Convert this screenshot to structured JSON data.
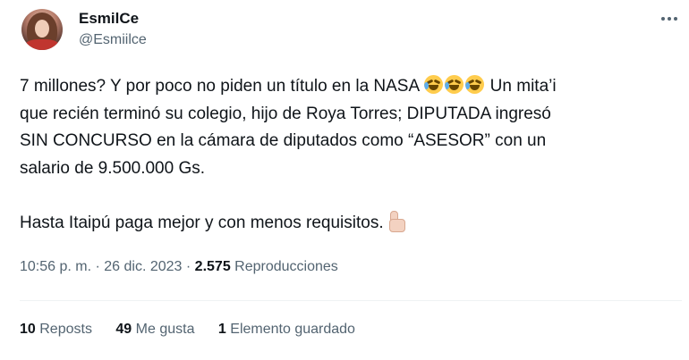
{
  "author": {
    "display_name": "EsmilCe",
    "handle": "@Esmiilce"
  },
  "tweet": {
    "line1_pre": "7 millones? Y por poco no piden un título en la NASA ",
    "line1_emojis": [
      "rolling-on-floor-laughing-emoji",
      "rolling-on-floor-laughing-emoji",
      "rolling-on-floor-laughing-emoji"
    ],
    "line1_post": " Un mita’i",
    "line2": "que recién terminó su colegio, hijo de Roya Torres; DIPUTADA ingresó",
    "line3": "SIN CONCURSO en la cámara de diputados como “ASESOR” con un",
    "line4": "salario de 9.500.000 Gs.",
    "line5": "Hasta Itaipú paga mejor y con menos requisitos.",
    "line5_emoji": "thumbs-up-emoji"
  },
  "meta": {
    "time": "10:56 p. m.",
    "separator": " · ",
    "date": "26 dic. 2023",
    "views_count": "2.575",
    "views_label": "Reproducciones"
  },
  "stats": {
    "reposts_count": "10",
    "reposts_label": "Reposts",
    "likes_count": "49",
    "likes_label": "Me gusta",
    "bookmarks_count": "1",
    "bookmarks_label": "Elemento guardado"
  },
  "colors": {
    "text": "#0f1419",
    "secondary": "#536471",
    "divider": "#eff3f4"
  }
}
